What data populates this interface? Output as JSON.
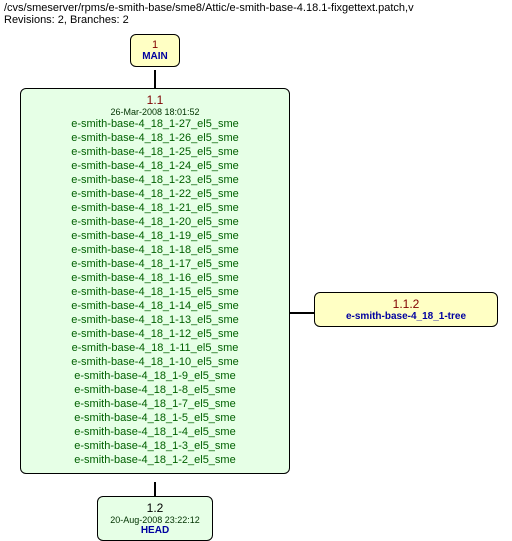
{
  "header": {
    "path": "/cvs/smeserver/rpms/e-smith-base/sme8/Attic/e-smith-base-4.18.1-fixgettext.patch,v",
    "meta": "Revisions: 2, Branches: 2"
  },
  "main": {
    "number": "1",
    "label": "MAIN"
  },
  "rev11": {
    "version": "1.1",
    "date": "26-Mar-2008 18:01:52",
    "tags": [
      "e-smith-base-4_18_1-27_el5_sme",
      "e-smith-base-4_18_1-26_el5_sme",
      "e-smith-base-4_18_1-25_el5_sme",
      "e-smith-base-4_18_1-24_el5_sme",
      "e-smith-base-4_18_1-23_el5_sme",
      "e-smith-base-4_18_1-22_el5_sme",
      "e-smith-base-4_18_1-21_el5_sme",
      "e-smith-base-4_18_1-20_el5_sme",
      "e-smith-base-4_18_1-19_el5_sme",
      "e-smith-base-4_18_1-18_el5_sme",
      "e-smith-base-4_18_1-17_el5_sme",
      "e-smith-base-4_18_1-16_el5_sme",
      "e-smith-base-4_18_1-15_el5_sme",
      "e-smith-base-4_18_1-14_el5_sme",
      "e-smith-base-4_18_1-13_el5_sme",
      "e-smith-base-4_18_1-12_el5_sme",
      "e-smith-base-4_18_1-11_el5_sme",
      "e-smith-base-4_18_1-10_el5_sme",
      "e-smith-base-4_18_1-9_el5_sme",
      "e-smith-base-4_18_1-8_el5_sme",
      "e-smith-base-4_18_1-7_el5_sme",
      "e-smith-base-4_18_1-5_el5_sme",
      "e-smith-base-4_18_1-4_el5_sme",
      "e-smith-base-4_18_1-3_el5_sme",
      "e-smith-base-4_18_1-2_el5_sme"
    ]
  },
  "branch": {
    "version": "1.1.2",
    "name": "e-smith-base-4_18_1-tree"
  },
  "rev12": {
    "version": "1.2",
    "date": "20-Aug-2008 23:22:12",
    "head": "HEAD"
  }
}
